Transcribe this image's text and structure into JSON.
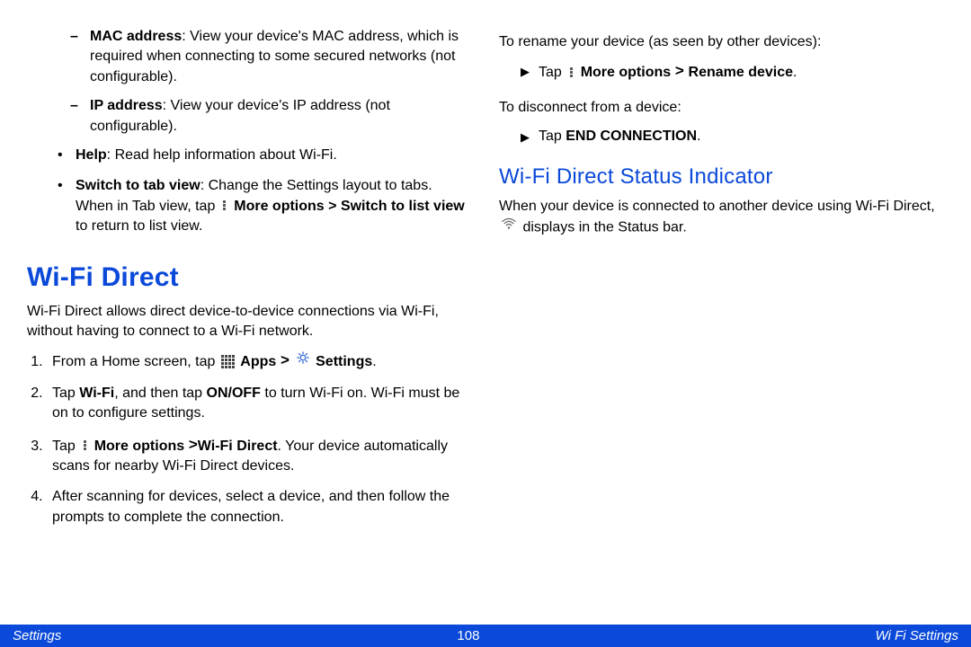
{
  "left": {
    "mac_label": "MAC address",
    "mac_text": ": View your device's MAC address, which is required when connecting to some secured networks (not configurable).",
    "ip_label": "IP address",
    "ip_text": ": View your device's IP address (not configurable).",
    "help_label": "Help",
    "help_text": ": Read help information about Wi-Fi.",
    "switch_label": "Switch to tab view",
    "switch_text_a": ": Change the Settings layout to tabs. When in Tab view, tap ",
    "switch_more": "More options",
    "switch_gt": " >",
    "switch_return_label": "Switch to list view",
    "switch_return_text": " to return to list view.",
    "h1": "Wi-Fi Direct",
    "intro": "Wi-Fi Direct allows direct device-to-device connections via Wi-Fi, without having to connect to a Wi-Fi network.",
    "s1a": "From a Home screen, tap ",
    "s1_apps": "Apps",
    "s1_gt": " > ",
    "s1_settings": "Settings",
    "s1_dot": ".",
    "s2a": "Tap ",
    "s2_wifi": "Wi-Fi",
    "s2b": ", and then tap ",
    "s2_onoff": "ON/OFF",
    "s2c": " to turn Wi-Fi on. Wi-Fi must be on to configure settings.",
    "s3a": "Tap ",
    "s3_more": "More options",
    "s3_gt2": " >",
    "s3_wfd": "Wi-Fi Direct",
    "s3b": ". Your device automatically scans for nearby Wi-Fi Direct devices.",
    "s4": "After scanning for devices, select a device, and then follow the prompts to complete the connection."
  },
  "right": {
    "rename_lead": "To rename your device (as seen by other devices):",
    "rename_tap": "Tap ",
    "rename_more": "More options",
    "rename_gt": " > ",
    "rename_device": "Rename device",
    "rename_dot": ".",
    "disconnect_lead": "To disconnect from a device:",
    "disconnect_tap": "Tap ",
    "disconnect_end": "END CONNECTION",
    "disconnect_dot": ".",
    "h2": "Wi-Fi Direct Status Indicator",
    "status_a": "When your device is connected to another device using Wi-Fi Direct, ",
    "status_b": " displays in the Status bar."
  },
  "icons": {
    "dots": "more-options-icon",
    "grid": "apps-grid-icon",
    "gear": "settings-gear-icon",
    "wifi": "wifi-direct-icon",
    "tri": "step-arrow-icon"
  },
  "footer": {
    "left": "Settings",
    "page": "108",
    "right": "Wi Fi Settings"
  }
}
